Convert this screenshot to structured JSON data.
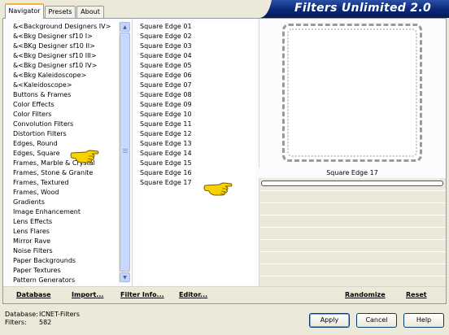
{
  "window": {
    "brand": "Filters Unlimited 2.0",
    "accent": "#0a2a7a"
  },
  "tabs": [
    {
      "label": "Navigator",
      "active": true
    },
    {
      "label": "Presets",
      "active": false
    },
    {
      "label": "About",
      "active": false
    }
  ],
  "categories": [
    "&<Background Designers IV>",
    "&<Bkg Designer sf10 I>",
    "&<BKg Designer sf10 II>",
    "&<Bkg Designer sf10 III>",
    "&<Bkg Designer sf10 IV>",
    "&<Bkg Kaleidoscope>",
    "&<Kaleidoscope>",
    "Buttons & Frames",
    "Color Effects",
    "Color Filters",
    "Convolution Filters",
    "Distortion Filters",
    "Edges, Round",
    "Edges, Square",
    "Frames, Marble & Crystal",
    "Frames, Stone & Granite",
    "Frames, Textured",
    "Frames, Wood",
    "Gradients",
    "Image Enhancement",
    "Lens Effects",
    "Lens Flares",
    "Mirror Rave",
    "Noise Filters",
    "Paper Backgrounds",
    "Paper Textures",
    "Pattern Generators"
  ],
  "selected_category": "Edges, Square",
  "filters": [
    "Square Edge 01",
    "Square Edge 02",
    "Square Edge 03",
    "Square Edge 04",
    "Square Edge 05",
    "Square Edge 06",
    "Square Edge 07",
    "Square Edge 08",
    "Square Edge 09",
    "Square Edge 10",
    "Square Edge 11",
    "Square Edge 12",
    "Square Edge 13",
    "Square Edge 14",
    "Square Edge 15",
    "Square Edge 16",
    "Square Edge 17"
  ],
  "selected_filter": "Square Edge 17",
  "preview": {
    "caption": "Square Edge 17"
  },
  "link_bar": {
    "database": "Database",
    "import": "Import...",
    "filter_info": "Filter Info...",
    "editor": "Editor...",
    "randomize": "Randomize",
    "reset": "Reset"
  },
  "status": {
    "database_label": "Database:",
    "database_value": "ICNET-Filters",
    "filters_label": "Filters:",
    "filters_value": "582"
  },
  "buttons": {
    "apply": "Apply",
    "cancel": "Cancel",
    "help": "Help"
  },
  "icons": {
    "pointer": "pointing-hand-icon",
    "scroll_up": "scroll-up-arrow-icon",
    "scroll_down": "scroll-down-arrow-icon"
  }
}
